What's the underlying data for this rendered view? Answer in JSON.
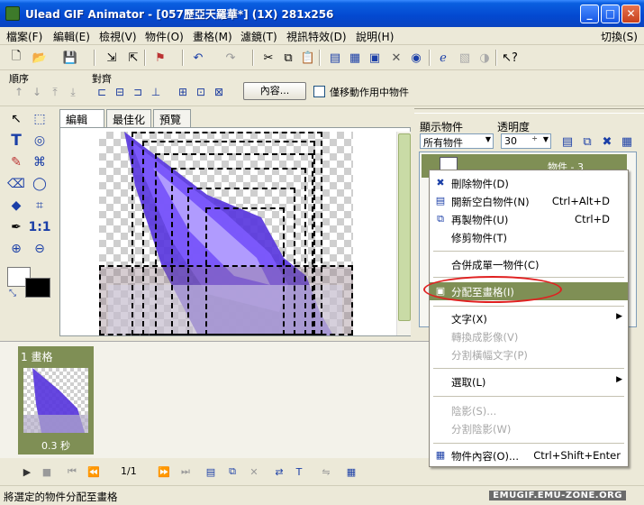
{
  "window": {
    "title": "Ulead GIF Animator - [057歷亞天羅華*] (1X) 281x256",
    "min": "_",
    "max": "□",
    "close": "✕"
  },
  "menu": {
    "items": [
      "檔案(F)",
      "編輯(E)",
      "檢視(V)",
      "物件(O)",
      "畫格(M)",
      "濾鏡(T)",
      "視訊特效(D)",
      "說明(H)"
    ],
    "switch": "切換(S)"
  },
  "align_bar": {
    "order_label": "順序",
    "align_label": "對齊",
    "properties_button": "內容...",
    "move_only_label": "僅移動作用中物件"
  },
  "tabs": [
    "編輯",
    "最佳化",
    "預覽"
  ],
  "right_panel": {
    "show_label": "顯示物件",
    "opacity_label": "透明度",
    "show_value": "所有物件",
    "opacity_value": "30",
    "object_row": "物件 - 3"
  },
  "context_menu": {
    "items": [
      {
        "label": "刪除物件(D)",
        "shortcut": "",
        "icon": "✖",
        "disabled": false
      },
      {
        "label": "開新空白物件(N)",
        "shortcut": "Ctrl+Alt+D",
        "icon": "▤",
        "disabled": false
      },
      {
        "label": "再製物件(U)",
        "shortcut": "Ctrl+D",
        "icon": "⧉",
        "disabled": false
      },
      {
        "label": "修剪物件(T)",
        "shortcut": "",
        "icon": "",
        "disabled": false
      },
      {
        "label": "合併成單一物件(C)",
        "shortcut": "",
        "icon": "",
        "disabled": false
      },
      {
        "label": "分配至畫格(I)",
        "shortcut": "",
        "icon": "▣",
        "disabled": false
      },
      {
        "label": "文字(X)",
        "shortcut": "",
        "icon": "",
        "disabled": false,
        "submenu": true
      },
      {
        "label": "轉換成影像(V)",
        "shortcut": "",
        "icon": "",
        "disabled": true
      },
      {
        "label": "分割橫幅文字(P)",
        "shortcut": "",
        "icon": "",
        "disabled": true
      },
      {
        "label": "選取(L)",
        "shortcut": "",
        "icon": "",
        "disabled": false,
        "submenu": true
      },
      {
        "label": "陰影(S)...",
        "shortcut": "",
        "icon": "",
        "disabled": true
      },
      {
        "label": "分割陰影(W)",
        "shortcut": "",
        "icon": "",
        "disabled": true
      },
      {
        "label": "物件內容(O)...",
        "shortcut": "Ctrl+Shift+Enter",
        "icon": "▦",
        "disabled": false
      }
    ],
    "arrow": "▶"
  },
  "frames": {
    "frame1_label": "1 畫格",
    "frame1_delay": "0.3 秒",
    "counter": "1/1"
  },
  "status": {
    "text": "將選定的物件分配至畫格",
    "watermark": "EMUGIF.EMU-ZONE.ORG"
  },
  "colors": {
    "accent": "#7f8f55",
    "titlebar": "#0348d0",
    "highlight_oval": "#e02020"
  }
}
